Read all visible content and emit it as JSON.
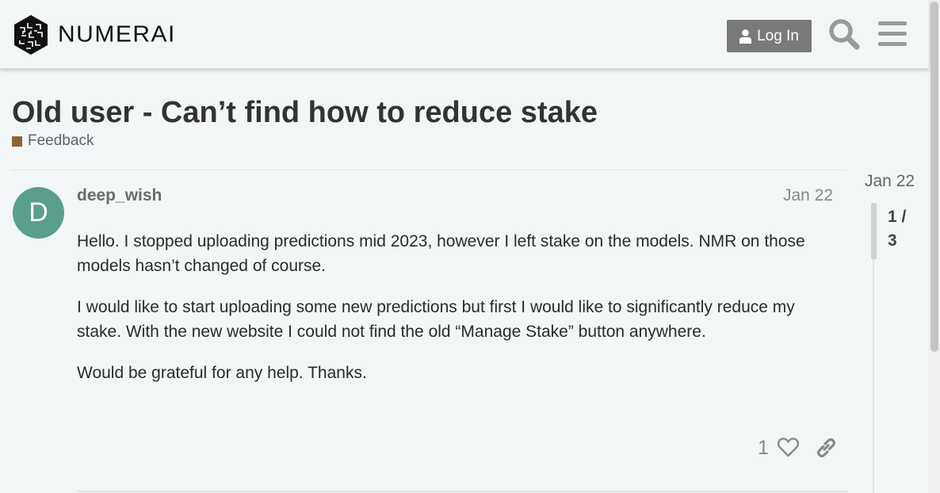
{
  "header": {
    "logo_text": "NUMERAI",
    "login_label": "Log In",
    "icons": [
      "numerai-logo-icon",
      "user-icon",
      "search-icon",
      "hamburger-menu-icon"
    ]
  },
  "topic": {
    "title": "Old user - Can’t find how to reduce stake",
    "category": "Feedback",
    "category_color": "#8c6238"
  },
  "post": {
    "avatar_letter": "D",
    "avatar_color": "#5a9e8e",
    "username": "deep_wish",
    "date": "Jan 22",
    "paragraphs": [
      "Hello. I stopped uploading predictions mid 2023, however I left stake on the models. NMR on those models hasn’t changed of course.",
      "I would like to start uploading some new predictions but first I would like to significantly reduce my stake. With the new website I could not find the old “Manage Stake” button anywhere.",
      "Would be grateful for any help. Thanks."
    ],
    "like_count": "1",
    "icons": [
      "heart-icon",
      "link-icon"
    ]
  },
  "timeline": {
    "date": "Jan 22",
    "counter_line1": "1 /",
    "counter_line2": "3"
  }
}
